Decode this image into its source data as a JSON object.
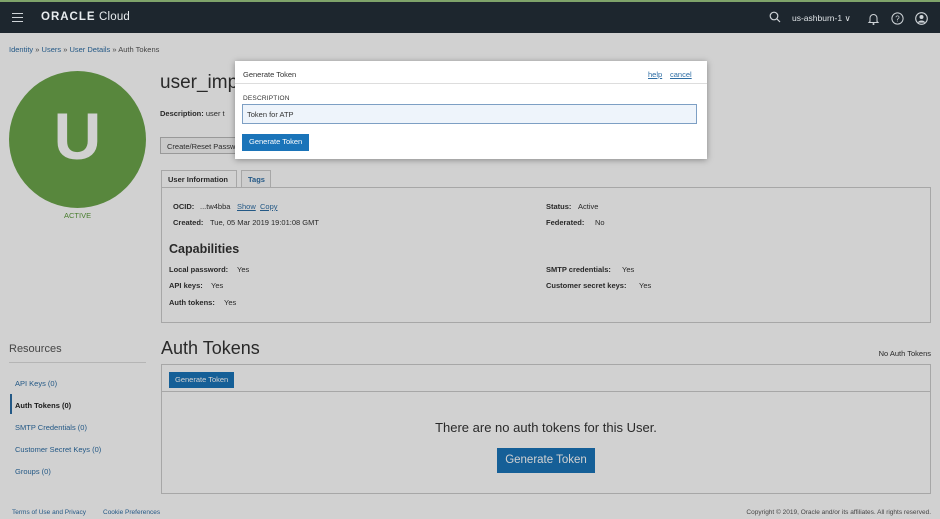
{
  "topbar": {
    "brand_strong": "ORACLE",
    "brand_light": " Cloud",
    "region": "us-ashburn-1 ∨"
  },
  "breadcrumb": {
    "identity": "Identity",
    "sep": " » ",
    "users": "Users",
    "user_details": "User Details",
    "current": "Auth Tokens"
  },
  "user": {
    "avatar_letter": "U",
    "status_text": "ACTIVE",
    "name": "user_imp",
    "description_label": "Description:",
    "description_value": "user t",
    "reset_button": "Create/Reset Passw"
  },
  "tabs": [
    "User Information",
    "Tags"
  ],
  "info": {
    "ocid_label": "OCID:",
    "ocid_value": "...tw4bba",
    "show": "Show",
    "copy": "Copy",
    "created_label": "Created:",
    "created_value": "Tue, 05 Mar 2019 19:01:08 GMT",
    "status_label": "Status:",
    "status_value": "Active",
    "federated_label": "Federated:",
    "federated_value": "No",
    "capabilities_title": "Capabilities",
    "local_password_label": "Local password:",
    "local_password_value": "Yes",
    "api_keys_label": "API keys:",
    "api_keys_value": "Yes",
    "auth_tokens_label": "Auth tokens:",
    "auth_tokens_value": "Yes",
    "smtp_label": "SMTP credentials:",
    "smtp_value": "Yes",
    "secret_label": "Customer secret keys:",
    "secret_value": "Yes"
  },
  "resources": {
    "title": "Resources",
    "items": [
      "API Keys (0)",
      "Auth Tokens (0)",
      "SMTP Credentials (0)",
      "Customer Secret Keys (0)",
      "Groups (0)"
    ]
  },
  "auth": {
    "title": "Auth Tokens",
    "no_tokens_label": "No Auth Tokens",
    "small_button": "Generate Token",
    "empty_message": "There are no auth tokens for this User.",
    "big_button": "Generate Token"
  },
  "footer": {
    "terms": "Terms of Use and Privacy",
    "cookies": "Cookie Preferences",
    "copyright": "Copyright © 2019, Oracle and/or its affiliates. All rights reserved."
  },
  "modal": {
    "title": "Generate Token",
    "help": "help",
    "cancel": "cancel",
    "field_label": "DESCRIPTION",
    "field_value": "Token for ATP",
    "submit": "Generate Token"
  }
}
